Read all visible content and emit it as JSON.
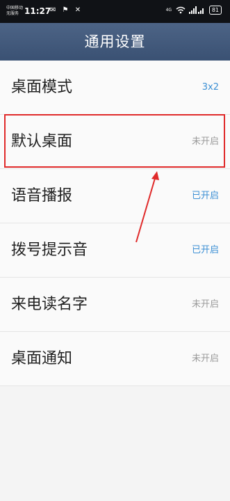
{
  "status_bar": {
    "carrier_line1": "中国移动",
    "carrier_line2": "无服务",
    "time": "11:27",
    "left_icons": "✉ ⚑ ✕",
    "signal_label": "4G",
    "battery": "81"
  },
  "header": {
    "title": "通用设置"
  },
  "settings": [
    {
      "label": "桌面模式",
      "value": "3x2",
      "state": "on"
    },
    {
      "label": "默认桌面",
      "value": "未开启",
      "state": "off"
    },
    {
      "label": "语音播报",
      "value": "已开启",
      "state": "on"
    },
    {
      "label": "拨号提示音",
      "value": "已开启",
      "state": "on"
    },
    {
      "label": "来电读名字",
      "value": "未开启",
      "state": "off"
    },
    {
      "label": "桌面通知",
      "value": "未开启",
      "state": "off"
    }
  ],
  "colors": {
    "header": "#43597c",
    "value_on": "#3b8fd4",
    "value_off": "#9a9a9a",
    "highlight": "#e02a2a"
  }
}
